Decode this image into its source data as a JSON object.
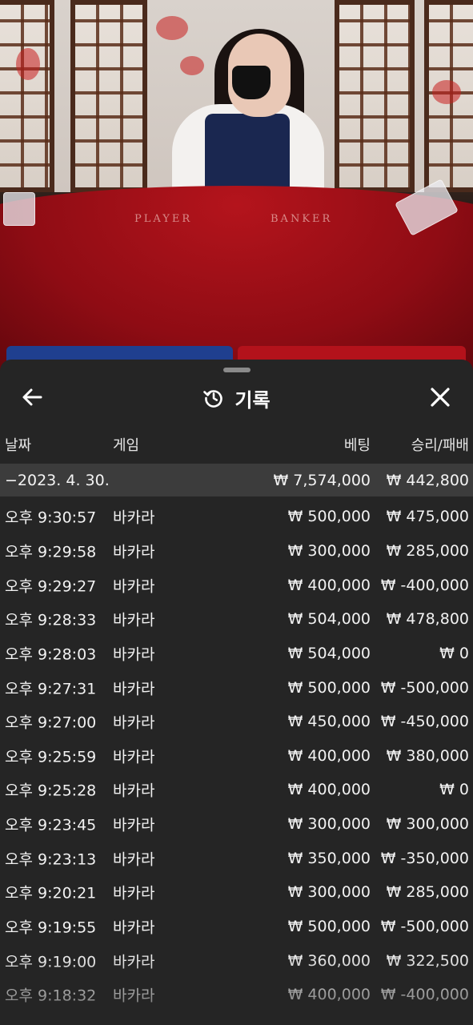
{
  "video": {
    "table_left_word": "PLAYER",
    "table_right_word": "BANKER"
  },
  "sheet": {
    "title": "기록",
    "icons": {
      "back": "arrow-left-icon",
      "history": "history-icon",
      "close": "close-icon"
    },
    "columns": {
      "date": "날짜",
      "game": "게임",
      "bet": "베팅",
      "result": "승리/패배"
    },
    "summary": {
      "date": "−2023. 4. 30.",
      "bet": "₩ 7,574,000",
      "result": "₩ 442,800"
    },
    "rows": [
      {
        "time": "오후 9:30:57",
        "game": "바카라",
        "bet": "₩ 500,000",
        "result": "₩ 475,000"
      },
      {
        "time": "오후 9:29:58",
        "game": "바카라",
        "bet": "₩ 300,000",
        "result": "₩ 285,000"
      },
      {
        "time": "오후 9:29:27",
        "game": "바카라",
        "bet": "₩ 400,000",
        "result": "₩ -400,000"
      },
      {
        "time": "오후 9:28:33",
        "game": "바카라",
        "bet": "₩ 504,000",
        "result": "₩ 478,800"
      },
      {
        "time": "오후 9:28:03",
        "game": "바카라",
        "bet": "₩ 504,000",
        "result": "₩ 0"
      },
      {
        "time": "오후 9:27:31",
        "game": "바카라",
        "bet": "₩ 500,000",
        "result": "₩ -500,000"
      },
      {
        "time": "오후 9:27:00",
        "game": "바카라",
        "bet": "₩ 450,000",
        "result": "₩ -450,000"
      },
      {
        "time": "오후 9:25:59",
        "game": "바카라",
        "bet": "₩ 400,000",
        "result": "₩ 380,000"
      },
      {
        "time": "오후 9:25:28",
        "game": "바카라",
        "bet": "₩ 400,000",
        "result": "₩ 0"
      },
      {
        "time": "오후 9:23:45",
        "game": "바카라",
        "bet": "₩ 300,000",
        "result": "₩ 300,000"
      },
      {
        "time": "오후 9:23:13",
        "game": "바카라",
        "bet": "₩ 350,000",
        "result": "₩ -350,000"
      },
      {
        "time": "오후 9:20:21",
        "game": "바카라",
        "bet": "₩ 300,000",
        "result": "₩ 285,000"
      },
      {
        "time": "오후 9:19:55",
        "game": "바카라",
        "bet": "₩ 500,000",
        "result": "₩ -500,000"
      },
      {
        "time": "오후 9:19:00",
        "game": "바카라",
        "bet": "₩ 360,000",
        "result": "₩ 322,500"
      },
      {
        "time": "오후 9:18:32",
        "game": "바카라",
        "bet": "₩ 400,000",
        "result": "₩ -400,000"
      }
    ]
  },
  "colors": {
    "sheet_bg": "#252525",
    "summary_bg": "#3c3c3c",
    "player_blue": "#1f3f8f",
    "banker_red": "#b3121b"
  }
}
